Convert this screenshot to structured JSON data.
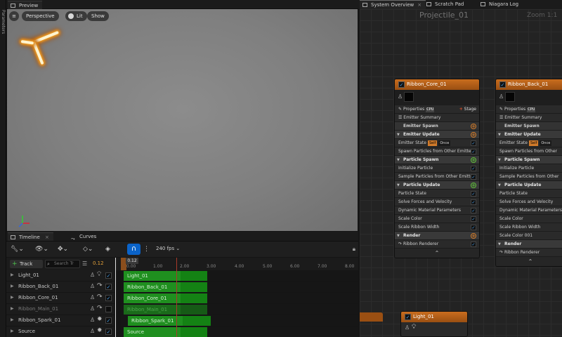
{
  "left_strip": {
    "label": "Parameters"
  },
  "preview": {
    "tab": "Preview",
    "buttons": {
      "menu": "≡",
      "perspective": "Perspective",
      "lit": "Lit",
      "show": "Show"
    }
  },
  "timeline": {
    "tabs": [
      "Timeline",
      "Curves"
    ],
    "fps": "240 fps",
    "track_button": "Track",
    "search_placeholder": "Search Tr",
    "current_time": "0.12",
    "playhead_label": "0.12",
    "ticks": [
      "0.00",
      "1.00",
      "2.00",
      "3.00",
      "4.00",
      "5.00",
      "6.00",
      "7.00",
      "8.00"
    ],
    "rows": [
      {
        "name": "Light_01",
        "bar": "Light_01",
        "dim": false,
        "checked": true
      },
      {
        "name": "Ribbon_Back_01",
        "bar": "Ribbon_Back_01",
        "dim": false,
        "checked": true
      },
      {
        "name": "Ribbon_Core_01",
        "bar": "Ribbon_Core_01",
        "dim": false,
        "checked": true
      },
      {
        "name": "Ribbon_Main_01",
        "bar": "Ribbon_Main_01",
        "dim": true,
        "checked": false
      },
      {
        "name": "Ribbon_Spark_01",
        "bar": "Ribbon_Spark_01",
        "dim": false,
        "checked": true
      },
      {
        "name": "Source",
        "bar": "Source",
        "dim": false,
        "checked": true
      }
    ]
  },
  "right_tabs": [
    "System Overview",
    "Scratch Pad",
    "Niagara Log"
  ],
  "graph": {
    "title": "Projectile_01",
    "zoom": "Zoom 1:1",
    "nodes": [
      {
        "title": "Ribbon_Core_01",
        "properties": "Properties",
        "stage": "Stage",
        "summary": "Emitter Summary",
        "spawn": "Emitter Spawn",
        "update": "Emitter Update",
        "state": "Emitter State",
        "state_badge": "Self",
        "state_mode": "Once",
        "spawn_from": "Spawn Particles from Other Emitter",
        "particle_spawn": "Particle Spawn",
        "init": "Initialize Particle",
        "sample": "Sample Particles from Other Emitter",
        "particle_update": "Particle Update",
        "update_items": [
          "Particle State",
          "Solve Forces and Velocity",
          "Dynamic Material Parameters",
          "Scale Color",
          "Scale Ribbon Width"
        ],
        "render": "Render",
        "renderer": "Ribbon Renderer"
      },
      {
        "title": "Ribbon_Back_01",
        "properties": "Properties",
        "summary": "Emitter Summary",
        "spawn": "Emitter Spawn",
        "update": "Emitter Update",
        "state": "Emitter State",
        "state_badge": "Self",
        "state_mode": "Once",
        "spawn_from": "Spawn Particles from Other Em",
        "particle_spawn": "Particle Spawn",
        "init": "Initialize Particle",
        "sample": "Sample Particles from Other Em",
        "particle_update": "Particle Update",
        "update_items": [
          "Particle State",
          "Solve Forces and Velocity",
          "Dynamic Material Parameters",
          "Scale Color",
          "Scale Ribbon Width",
          "Scale Color 001"
        ],
        "render": "Render",
        "renderer": "Ribbon Renderer"
      }
    ],
    "light_node": {
      "title": "Light_01"
    }
  },
  "colors": {
    "accent": "#0a63c9",
    "node_header": "#c96d1e",
    "track_green": "#1f8f1f",
    "time_orange": "#e3a13a"
  }
}
